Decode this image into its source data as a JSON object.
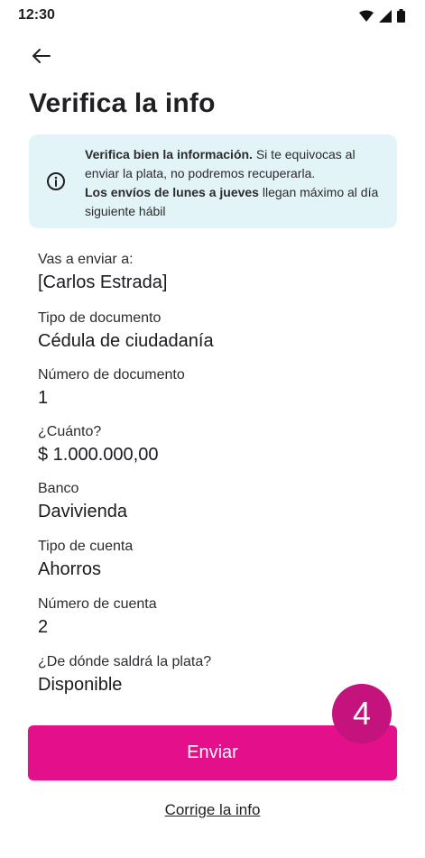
{
  "status_bar": {
    "time": "12:30"
  },
  "header": {
    "title": "Verifica la info"
  },
  "info_banner": {
    "bold1": "Verifica bien la información.",
    "text1": " Si te equivocas al enviar la plata, no podremos recuperarla.",
    "bold2": "Los envíos de lunes a jueves",
    "text2": " llegan máximo al día siguiente hábil"
  },
  "details": [
    {
      "label": "Vas a enviar a:",
      "value": "[Carlos Estrada]"
    },
    {
      "label": "Tipo de documento",
      "value": "Cédula de ciudadanía"
    },
    {
      "label": "Número de documento",
      "value": "1"
    },
    {
      "label": "¿Cuánto?",
      "value": "$ 1.000.000,00"
    },
    {
      "label": "Banco",
      "value": "Davivienda"
    },
    {
      "label": "Tipo de cuenta",
      "value": "Ahorros"
    },
    {
      "label": "Número de cuenta",
      "value": "2"
    },
    {
      "label": "¿De dónde saldrá la plata?",
      "value": "Disponible"
    }
  ],
  "step_badge": "4",
  "actions": {
    "submit_label": "Enviar",
    "correct_label": "Corrige la info"
  },
  "colors": {
    "primary": "#e30f8b",
    "badge": "#c4137c",
    "banner_bg": "#e3f4f8"
  }
}
